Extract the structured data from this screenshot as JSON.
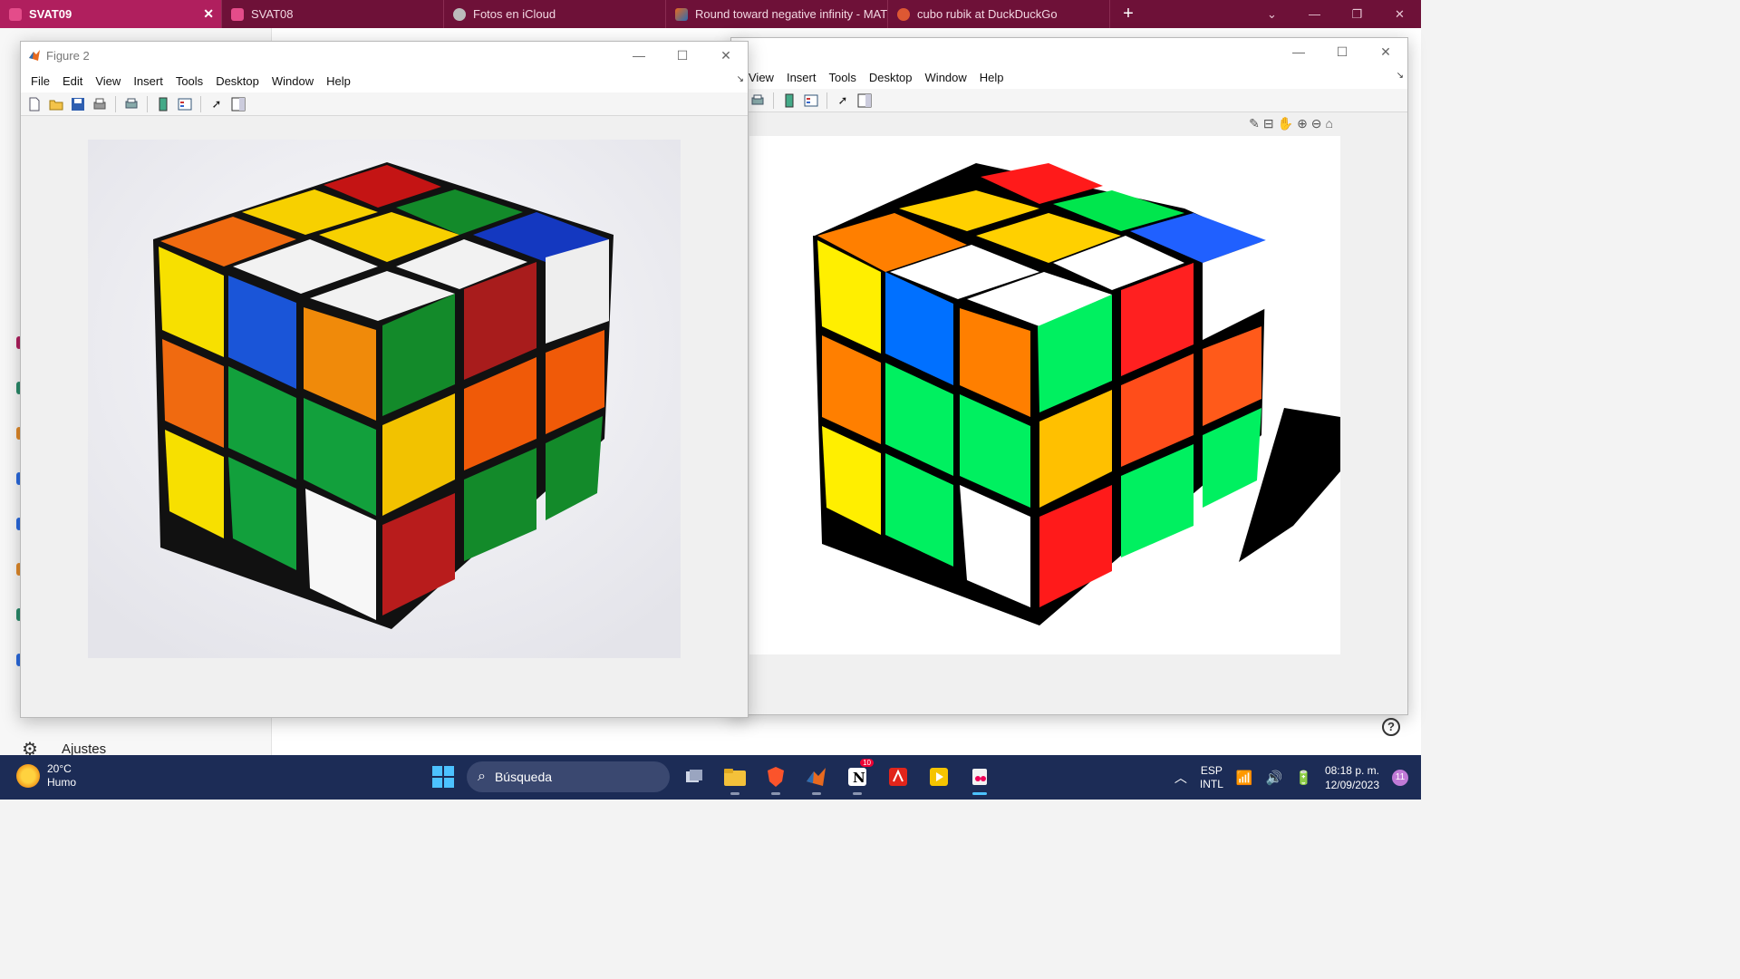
{
  "browser": {
    "tabs": [
      {
        "label": "SVAT09",
        "active": true,
        "icon": "profile-icon"
      },
      {
        "label": "SVAT08",
        "active": false,
        "icon": "profile-icon"
      },
      {
        "label": "Fotos en iCloud",
        "active": false,
        "icon": "apple-icon"
      },
      {
        "label": "Round toward negative infinity - MATL",
        "active": false,
        "icon": "matlab-icon"
      },
      {
        "label": "cubo rubik at DuckDuckGo",
        "active": false,
        "icon": "duckduckgo-icon"
      }
    ],
    "sidebar_bottom_label": "Ajustes"
  },
  "figure1": {
    "menu": [
      "View",
      "Insert",
      "Tools",
      "Desktop",
      "Window",
      "Help"
    ]
  },
  "figure2": {
    "title": "Figure 2",
    "menu": [
      "File",
      "Edit",
      "View",
      "Insert",
      "Tools",
      "Desktop",
      "Window",
      "Help"
    ]
  },
  "taskbar": {
    "weather_temp": "20°C",
    "weather_desc": "Humo",
    "search_placeholder": "Búsqueda",
    "lang_top": "ESP",
    "lang_bottom": "INTL",
    "time": "08:18 p. m.",
    "date": "12/09/2023",
    "notif_count": "11",
    "notion_badge": "10"
  },
  "colors": {
    "browser_accent": "#b01f5e",
    "browser_bar": "#6e1138",
    "taskbar": "#1c2c56"
  }
}
